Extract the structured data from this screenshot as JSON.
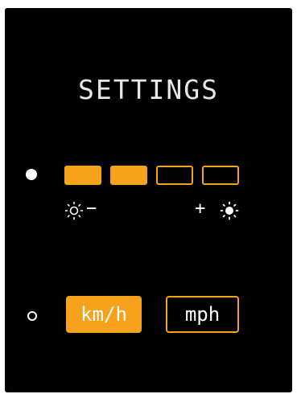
{
  "screen": {
    "title": "SETTINGS"
  },
  "brightness": {
    "level": 2,
    "max": 4,
    "decrease_sign": "−",
    "increase_sign": "+",
    "decrease_icon": "sun-dim-icon",
    "increase_icon": "sun-bright-icon",
    "selected": true
  },
  "units": {
    "options": [
      "km/h",
      "mph"
    ],
    "selected": "km/h",
    "row_selected": false
  },
  "colors": {
    "accent": "#f6a21d",
    "background": "#000000",
    "text": "#ffffff"
  }
}
